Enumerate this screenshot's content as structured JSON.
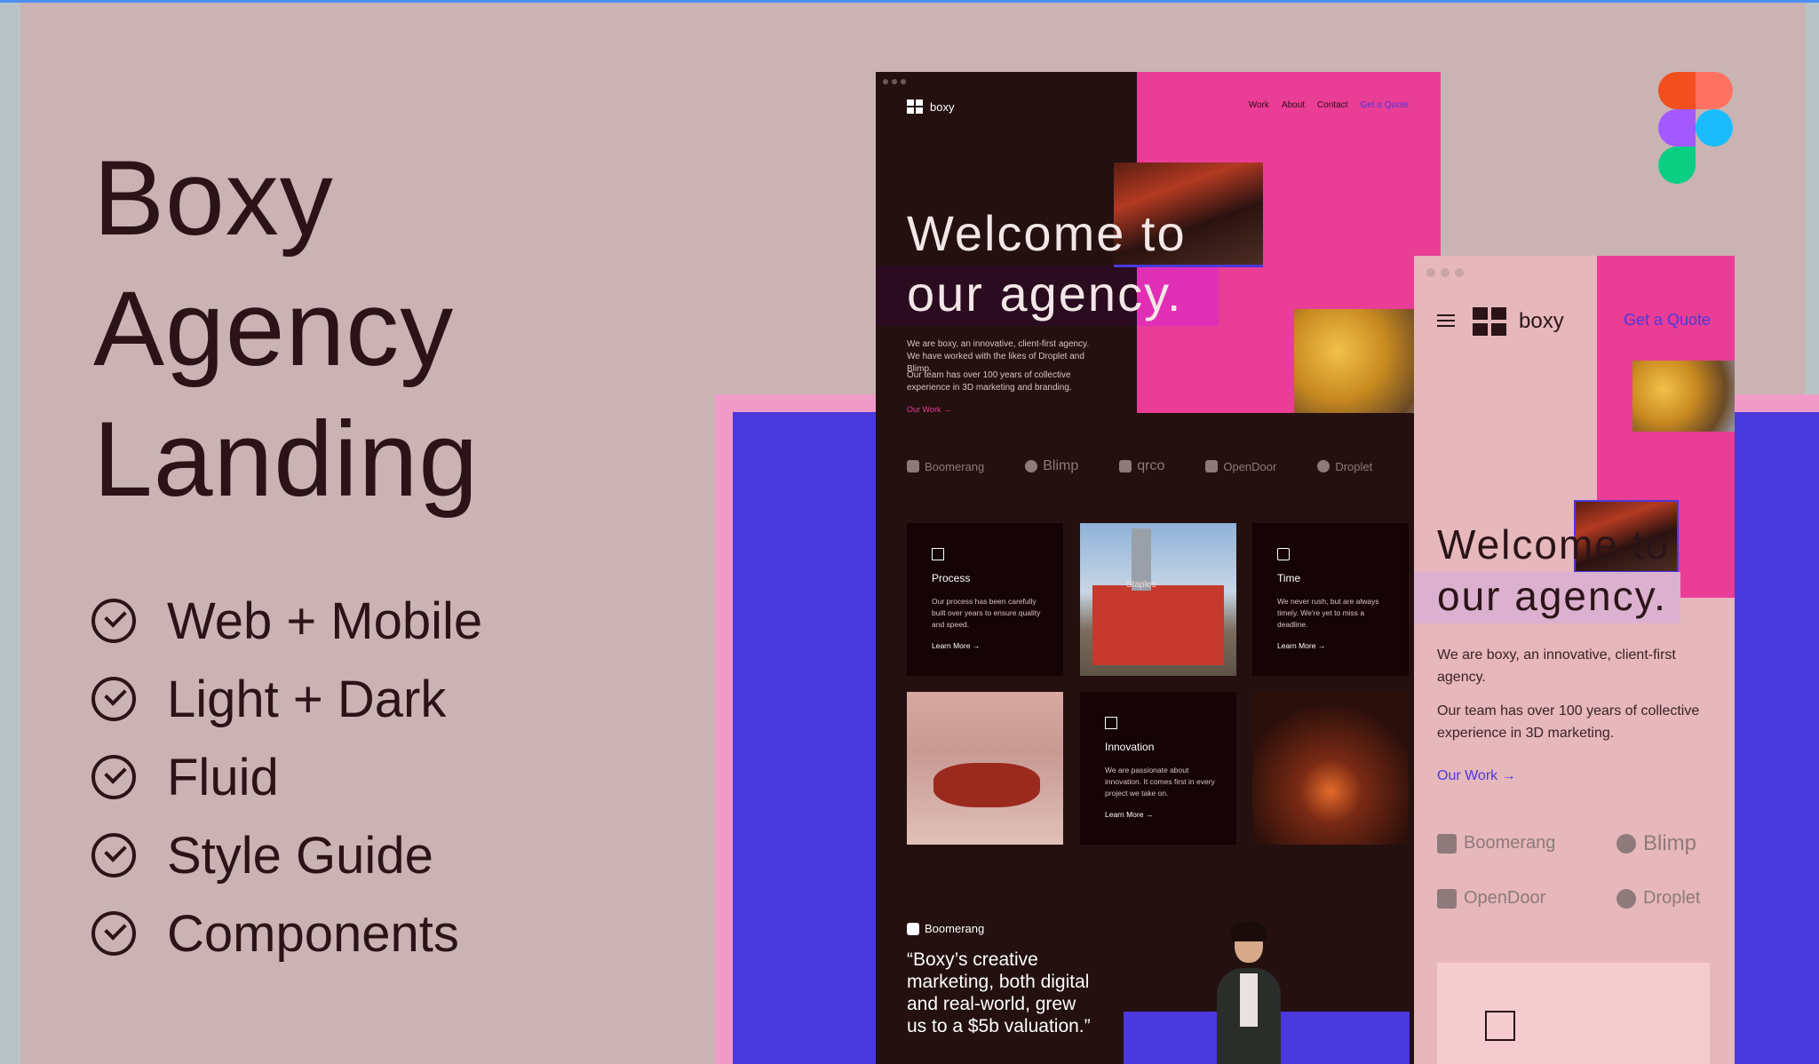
{
  "title_lines": [
    "Boxy",
    "Agency",
    "Landing"
  ],
  "features": [
    "Web + Mobile",
    "Light + Dark",
    "Fluid",
    "Style Guide",
    "Components"
  ],
  "desktop": {
    "logo": "boxy",
    "nav": [
      "Work",
      "About",
      "Contact",
      "Get a Quote"
    ],
    "hero": [
      "Welcome to",
      "our agency."
    ],
    "intro_1": "We are boxy, an innovative, client-first agency. We have worked with the likes of Droplet and Blimp.",
    "intro_2": "Our team has over 100 years of collective experience in 3D marketing and branding.",
    "our_work": "Our Work →",
    "brands": [
      "Boomerang",
      "Blimp",
      "qrco",
      "OpenDoor",
      "Droplet"
    ],
    "cards": [
      {
        "title": "Process",
        "text": "Our process has been carefully built over years to ensure quality and speed.",
        "link": "Learn More →"
      },
      {
        "title": "Time",
        "text": "We never rush, but are always timely. We're yet to miss a deadline.",
        "link": "Learn More →"
      },
      {
        "title": "Innovation",
        "text": "We are passionate about innovation. It comes first in every project we take on.",
        "link": "Learn More →"
      }
    ],
    "staples_label": "Staples",
    "quote_brand": "Boomerang",
    "quote": "“Boxy’s creative marketing, both digital and real-world, grew us to a $5b valuation.”"
  },
  "mobile": {
    "logo": "boxy",
    "get_quote": "Get a Quote",
    "hero": [
      "Welcome to",
      "our agency."
    ],
    "intro_1": "We are boxy, an innovative, client-first agency.",
    "intro_2": "Our team has over 100 years of collective experience in 3D marketing.",
    "our_work": "Our Work →",
    "brands": [
      "Boomerang",
      "Blimp",
      "OpenDoor",
      "Droplet"
    ]
  },
  "colors": {
    "background": "#c9b3b3",
    "text_dark": "#2b1418",
    "accent_pink": "#ea3d95",
    "accent_blue": "#4a39dd",
    "desktop_bg": "#23100f",
    "mobile_bg": "#e6b7bb"
  },
  "icons": [
    "check-circle-icon",
    "figma-logo-icon",
    "boxy-logo-icon",
    "menu-icon",
    "arrow-right-icon"
  ]
}
